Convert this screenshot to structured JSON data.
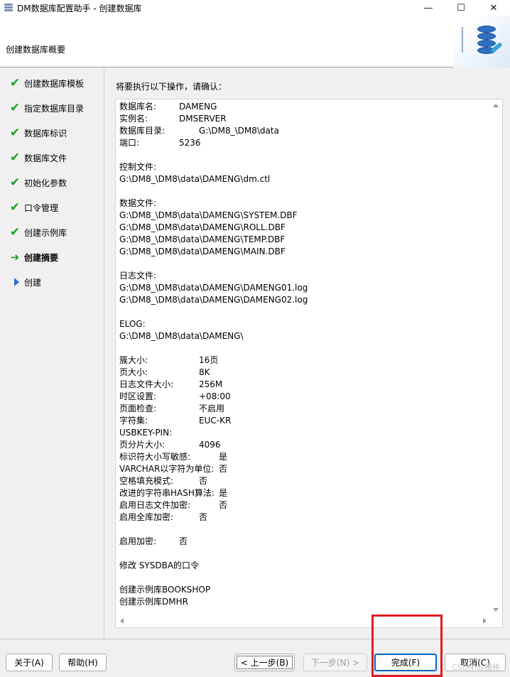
{
  "window": {
    "title": "DM数据库配置助手 - 创建数据库",
    "controls": {
      "minimize": "—",
      "maximize": "☐",
      "close": "✕"
    }
  },
  "header": {
    "title": "创建数据库概要",
    "icon": "database-icon"
  },
  "sidebar": {
    "steps": [
      {
        "label": "创建数据库模板",
        "state": "done"
      },
      {
        "label": "指定数据库目录",
        "state": "done"
      },
      {
        "label": "数据库标识",
        "state": "done"
      },
      {
        "label": "数据库文件",
        "state": "done"
      },
      {
        "label": "初始化参数",
        "state": "done"
      },
      {
        "label": "口令管理",
        "state": "done"
      },
      {
        "label": "创建示例库",
        "state": "done"
      },
      {
        "label": "创建摘要",
        "state": "current"
      },
      {
        "label": "创建",
        "state": "pending"
      }
    ]
  },
  "main": {
    "confirm_label": "将要执行以下操作，请确认：",
    "summary": {
      "db_name": {
        "k": "数据库名:",
        "v": "DAMENG"
      },
      "instance": {
        "k": "实例名:",
        "v": "DMSERVER"
      },
      "db_dir": {
        "k": "数据库目录:",
        "v": "G:\\DM8_\\DM8\\data"
      },
      "port": {
        "k": "端口:",
        "v": "5236"
      },
      "control_file_heading": "控制文件:",
      "control_file": "G:\\DM8_\\DM8\\data\\DAMENG\\dm.ctl",
      "data_files_heading": "数据文件:",
      "data_files": [
        "G:\\DM8_\\DM8\\data\\DAMENG\\SYSTEM.DBF",
        "G:\\DM8_\\DM8\\data\\DAMENG\\ROLL.DBF",
        "G:\\DM8_\\DM8\\data\\DAMENG\\TEMP.DBF",
        "G:\\DM8_\\DM8\\data\\DAMENG\\MAIN.DBF"
      ],
      "log_files_heading": "日志文件:",
      "log_files": [
        "G:\\DM8_\\DM8\\data\\DAMENG\\DAMENG01.log",
        "G:\\DM8_\\DM8\\data\\DAMENG\\DAMENG02.log"
      ],
      "elog_heading": "ELOG:",
      "elog": "G:\\DM8_\\DM8\\data\\DAMENG\\",
      "params": [
        {
          "k": "簇大小:",
          "v": "16页"
        },
        {
          "k": "页大小:",
          "v": "8K"
        },
        {
          "k": "日志文件大小:",
          "v": "256M"
        },
        {
          "k": "时区设置:",
          "v": "+08:00"
        },
        {
          "k": "页面检查:",
          "v": "不启用"
        },
        {
          "k": "字符集:",
          "v": "EUC-KR"
        },
        {
          "k": "USBKEY-PIN:",
          "v": ""
        },
        {
          "k": "页分片大小:",
          "v": "4096"
        }
      ],
      "options": [
        {
          "k": "标识符大小写敏感:",
          "v": "是"
        },
        {
          "k": "VARCHAR以字符为单位:",
          "v": "否"
        },
        {
          "k": "空格填充模式:",
          "v": "否"
        },
        {
          "k": "改进的字符串HASH算法:",
          "v": "是"
        },
        {
          "k": "启用日志文件加密:",
          "v": "否"
        },
        {
          "k": "启用全库加密:",
          "v": "否"
        }
      ],
      "encryption": {
        "k": "启用加密:",
        "v": "否"
      },
      "sysdba": "修改 SYSDBA的口令",
      "samples": [
        "创建示例库BOOKSHOP",
        "创建示例库DMHR"
      ]
    }
  },
  "footer": {
    "about": "关于(A)",
    "help": "帮助(H)",
    "prev": "< 上一步(B)",
    "next": "下一步(N) >",
    "finish": "完成(F)",
    "cancel": "取消(C)",
    "watermark": "CSDN @模移"
  },
  "colors": {
    "check": "#1e9e2a",
    "pending_arrow": "#2c6fd1",
    "highlight": "#e01b24"
  }
}
